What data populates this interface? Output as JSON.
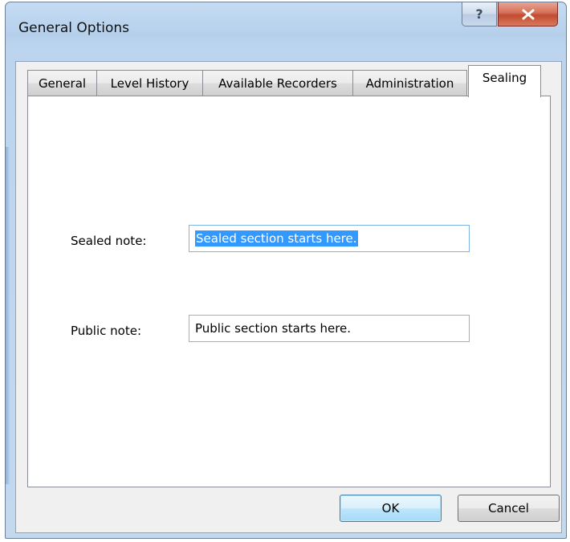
{
  "window": {
    "title": "General Options",
    "help_glyph": "?",
    "close_icon": "close-icon",
    "help_icon": "help-icon"
  },
  "tabs": [
    {
      "label": "General",
      "active": false
    },
    {
      "label": "Level History",
      "active": false
    },
    {
      "label": "Available Recorders",
      "active": false
    },
    {
      "label": "Administration",
      "active": false
    },
    {
      "label": "Sealing",
      "active": true
    }
  ],
  "form": {
    "sealed_label": "Sealed note:",
    "sealed_value": "Sealed section starts here.",
    "public_label": "Public note:",
    "public_value": "Public section starts here."
  },
  "buttons": {
    "ok": "OK",
    "cancel": "Cancel"
  },
  "colors": {
    "frame": "#bcd4ee",
    "close_red": "#c24a2f",
    "selection": "#3399ff",
    "default_button": "#bee6fd"
  }
}
